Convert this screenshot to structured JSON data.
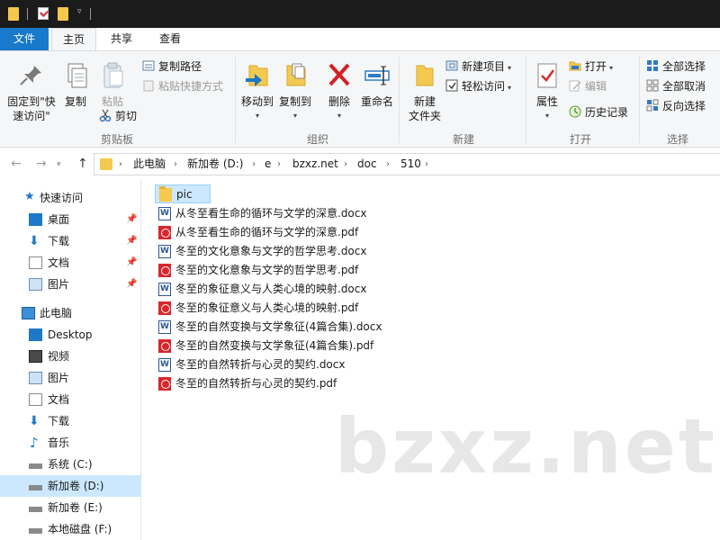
{
  "ribbon_tabs": [
    "文件",
    "主页",
    "共享",
    "查看"
  ],
  "clipboard": {
    "pin_label": "固定到\"快速访问\"",
    "copy_label": "复制",
    "paste_label": "粘贴",
    "copy_path_label": "复制路径",
    "paste_shortcut_label": "粘贴快捷方式",
    "cut_label": "剪切",
    "group_label": "剪贴板"
  },
  "organize": {
    "move_to_label": "移动到",
    "copy_to_label": "复制到",
    "delete_label": "删除",
    "rename_label": "重命名",
    "group_label": "组织"
  },
  "new_group": {
    "new_folder_label": "新建\n文件夹",
    "new_item_label": "新建项目",
    "easy_access_label": "轻松访问",
    "group_label": "新建"
  },
  "open_group": {
    "properties_label": "属性",
    "open_label": "打开",
    "edit_label": "编辑",
    "history_label": "历史记录",
    "group_label": "打开"
  },
  "select_group": {
    "select_all_label": "全部选择",
    "select_none_label": "全部取消",
    "invert_label": "反向选择",
    "group_label": "选择"
  },
  "breadcrumb": [
    "此电脑",
    "新加卷 (D:)",
    "e",
    "bzxz.net",
    "doc",
    "510"
  ],
  "nav": {
    "quick_access_label": "快速访问",
    "quick_items": [
      "桌面",
      "下载",
      "文档",
      "图片"
    ],
    "this_pc_label": "此电脑",
    "pc_items": [
      "Desktop",
      "视频",
      "图片",
      "文档",
      "下载",
      "音乐",
      "系统 (C:)",
      "新加卷 (D:)",
      "新加卷 (E:)",
      "本地磁盘 (F:)"
    ],
    "selected_item": "新加卷 (D:)"
  },
  "files": [
    {
      "name": "pic",
      "type": "folder"
    },
    {
      "name": "从冬至看生命的循环与文学的深意.docx",
      "type": "docx"
    },
    {
      "name": "从冬至看生命的循环与文学的深意.pdf",
      "type": "pdf"
    },
    {
      "name": "冬至的文化意象与文学的哲学思考.docx",
      "type": "docx"
    },
    {
      "name": "冬至的文化意象与文学的哲学思考.pdf",
      "type": "pdf"
    },
    {
      "name": "冬至的象征意义与人类心境的映射.docx",
      "type": "docx"
    },
    {
      "name": "冬至的象征意义与人类心境的映射.pdf",
      "type": "pdf"
    },
    {
      "name": "冬至的自然变换与文学象征(4篇合集).docx",
      "type": "docx"
    },
    {
      "name": "冬至的自然变换与文学象征(4篇合集).pdf",
      "type": "pdf"
    },
    {
      "name": "冬至的自然转折与心灵的契约.docx",
      "type": "docx"
    },
    {
      "name": "冬至的自然转折与心灵的契约.pdf",
      "type": "pdf"
    }
  ],
  "watermark": "bzxz.net",
  "colors": {
    "accent": "#1979ca",
    "selection": "#cce8ff",
    "folder": "#f4c94f",
    "pdf": "#d9262d",
    "docx": "#2b5797"
  }
}
